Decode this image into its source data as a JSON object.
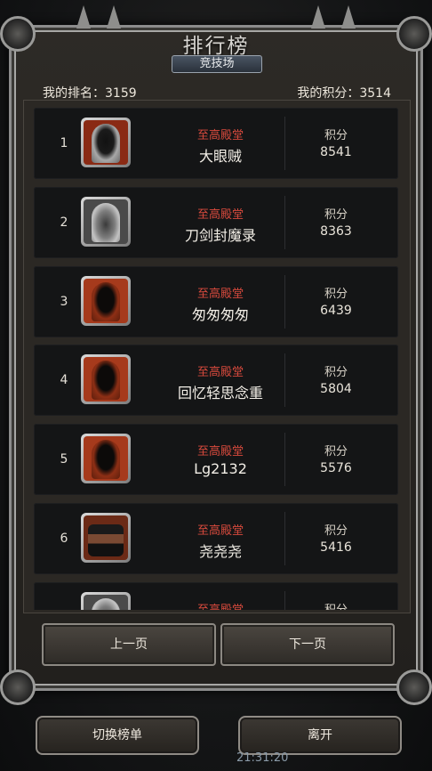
{
  "header": {
    "title": "排行榜",
    "subtitle": "竞技场",
    "my_rank": "我的排名：3159",
    "my_score": "我的积分：3514"
  },
  "rows": [
    {
      "rank": "1",
      "guild": "至高殿堂",
      "name": "大眼贼",
      "score_label": "积分",
      "score": "8541",
      "avatar": "grey-hood-avatar"
    },
    {
      "rank": "2",
      "guild": "至高殿堂",
      "name": "刀剑封魔录",
      "score_label": "积分",
      "score": "8363",
      "avatar": "knight-helmet-avatar"
    },
    {
      "rank": "3",
      "guild": "至高殿堂",
      "name": "匆匆匆匆",
      "score_label": "积分",
      "score": "6439",
      "avatar": "red-hood-avatar"
    },
    {
      "rank": "4",
      "guild": "至高殿堂",
      "name": "回忆轻思念重",
      "score_label": "积分",
      "score": "5804",
      "avatar": "red-hood-avatar"
    },
    {
      "rank": "5",
      "guild": "至高殿堂",
      "name": "Lg2132",
      "score_label": "积分",
      "score": "5576",
      "avatar": "red-hood-avatar"
    },
    {
      "rank": "6",
      "guild": "至高殿堂",
      "name": "尧尧尧",
      "score_label": "积分",
      "score": "5416",
      "avatar": "hat-rogue-avatar"
    },
    {
      "rank": "",
      "guild": "至高殿堂",
      "name": "",
      "score_label": "积分",
      "score": "",
      "avatar": "knight-helmet-avatar"
    }
  ],
  "pager": {
    "prev_label": "上一页",
    "next_label": "下一页"
  },
  "bottom": {
    "switch_label": "切换榜单",
    "leave_label": "离开",
    "clock": "21:31:20"
  }
}
